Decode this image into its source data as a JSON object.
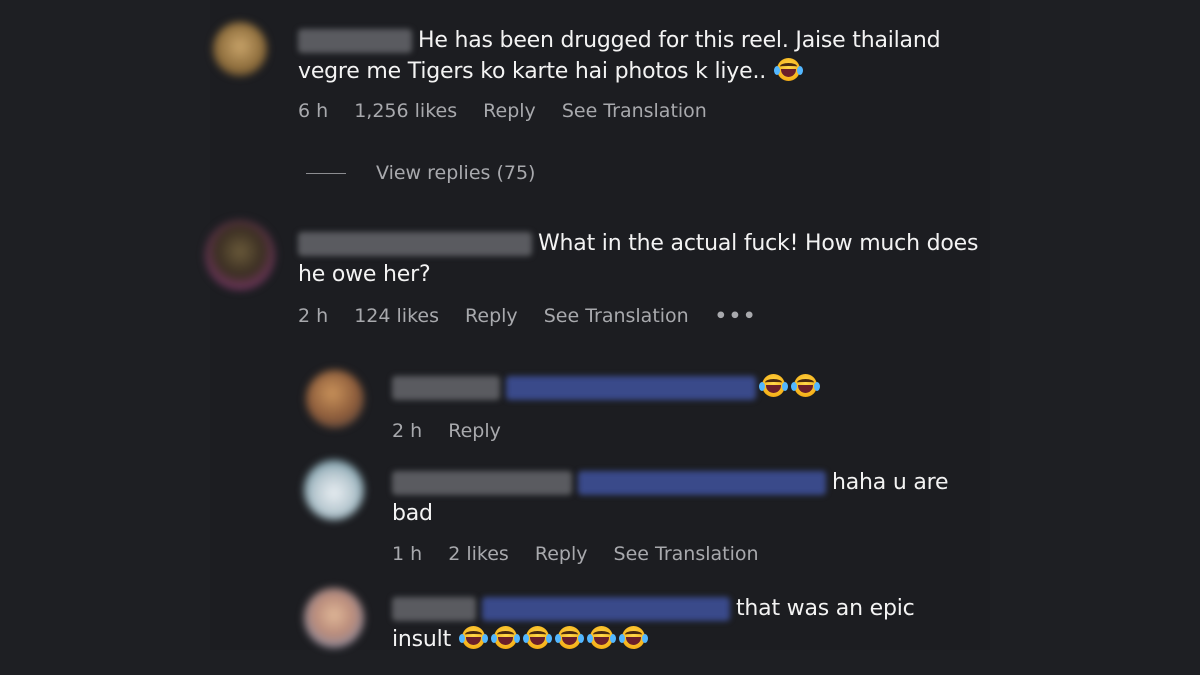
{
  "comments": [
    {
      "text": "He has been drugged for this reel. Jaise thailand vegre me Tigers ko karte hai photos k liye..",
      "time": "6 h",
      "likes": "1,256 likes",
      "reply": "Reply",
      "translate": "See Translation",
      "view_replies": "View replies (75)"
    },
    {
      "text_line1": "What in the actual fuck! How much does",
      "text_line2": "he owe her?",
      "time": "2 h",
      "likes": "124 likes",
      "reply": "Reply",
      "translate": "See Translation",
      "more": "•••",
      "replies": [
        {
          "time": "2 h",
          "reply": "Reply"
        },
        {
          "text_line1": "haha u are",
          "text_line2": "bad",
          "time": "1 h",
          "likes": "2 likes",
          "reply": "Reply",
          "translate": "See Translation"
        },
        {
          "text_line1": "that was an epic",
          "text_line2": "insult"
        }
      ]
    }
  ],
  "colors": {
    "background": "#1e1f23",
    "text": "#f3f3f3",
    "meta": "#a8a9ad",
    "mention": "#3a4a8a"
  },
  "icons": {
    "laughing_emoji": "face-with-tears-of-joy-icon"
  }
}
